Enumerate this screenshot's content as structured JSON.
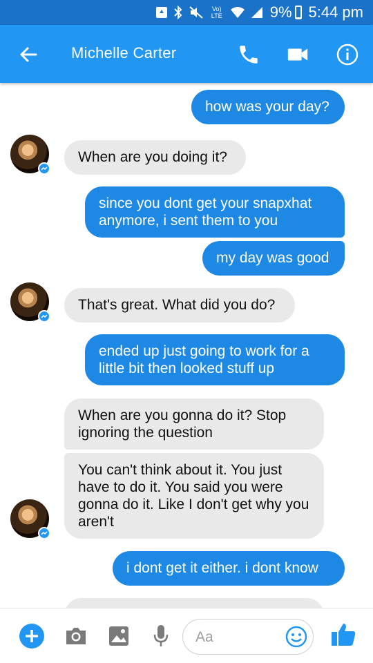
{
  "status_bar": {
    "volte_label": "Vo) LTE",
    "battery_percent": "9%",
    "battery_level": 0.09,
    "time": "5:44 pm"
  },
  "header": {
    "contact_name": "Michelle Carter",
    "icons": [
      "back-arrow-icon",
      "phone-icon",
      "video-camera-icon",
      "info-icon"
    ],
    "background_color": "#2196f3"
  },
  "messages": [
    {
      "from": "me",
      "text": "how was your day?"
    },
    {
      "from": "contact",
      "text": "When are you doing it?"
    },
    {
      "from": "me",
      "text": "since you dont get your snapxhat anymore, i sent them to you"
    },
    {
      "from": "me",
      "text": "my day was good"
    },
    {
      "from": "contact",
      "text": "That's great. What did you do?"
    },
    {
      "from": "me",
      "text": "ended up just going to work for a little bit then looked stuff up"
    },
    {
      "from": "contact",
      "text": "When are you gonna do it? Stop ignoring the question"
    },
    {
      "from": "contact",
      "text": "You can't think about it. You just have to do it. You said you were gonna do it. Like I don't get why you aren't"
    },
    {
      "from": "me",
      "text": "i dont get it either. i dont know"
    }
  ],
  "composer": {
    "placeholder": "Aa",
    "icons": [
      "add-icon",
      "camera-icon",
      "gallery-icon",
      "microphone-icon",
      "emoji-icon",
      "thumbs-up-icon"
    ]
  },
  "colors": {
    "outgoing_bubble": "#1e88e5",
    "incoming_bubble": "#e9e9e9",
    "accent": "#2196f3"
  }
}
